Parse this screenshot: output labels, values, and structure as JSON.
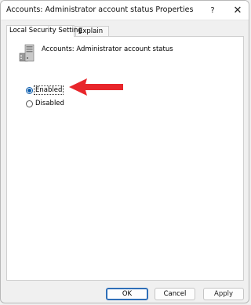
{
  "window": {
    "title": "Accounts: Administrator account status Properties",
    "help_label": "?",
    "close_label": "✕"
  },
  "tabs": [
    {
      "label": "Local Security Setting",
      "active": true
    },
    {
      "label": "Explain",
      "active": false
    }
  ],
  "policy": {
    "name": "Accounts: Administrator account status",
    "icon": "server-policy-icon"
  },
  "options": {
    "enabled": {
      "label": "Enabled",
      "selected": true
    },
    "disabled": {
      "label": "Disabled",
      "selected": false
    }
  },
  "annotation": {
    "icon": "red-arrow-icon",
    "color": "#e8262b"
  },
  "buttons": {
    "ok": "OK",
    "cancel": "Cancel",
    "apply": "Apply"
  },
  "colors": {
    "accent": "#0b5cad",
    "arrow": "#e8262b"
  }
}
